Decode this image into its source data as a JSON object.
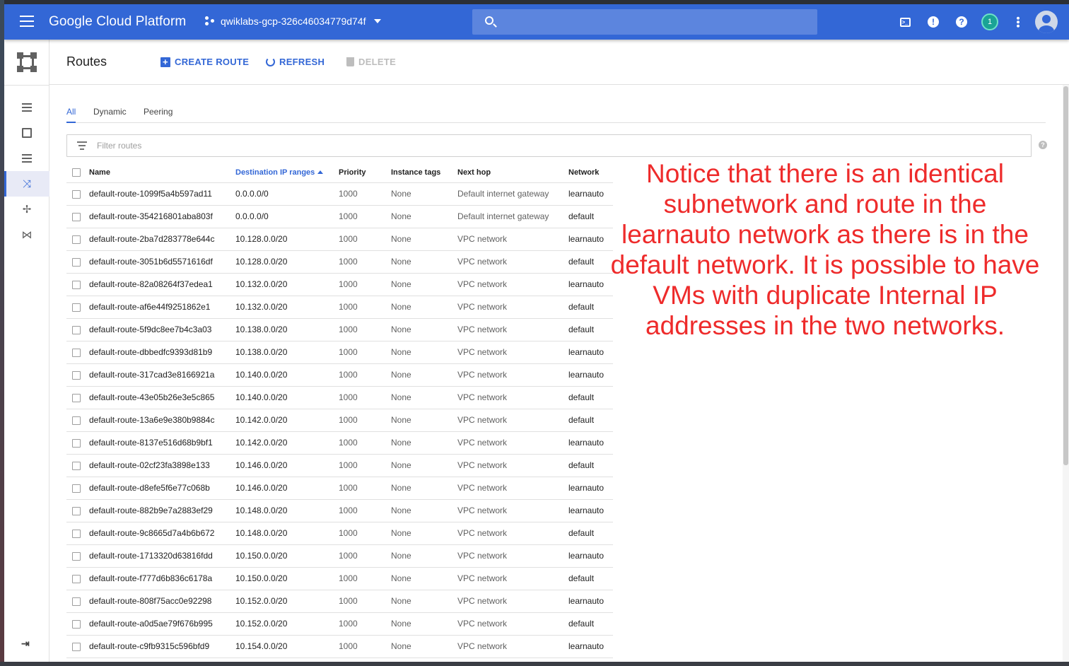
{
  "topbar": {
    "brand": "Google Cloud Platform",
    "project": "qwiklabs-gcp-326c46034779d74f",
    "search_placeholder": "",
    "notifications_count": "1",
    "shell_icon": "cloud-shell-icon",
    "alert_icon": "alert-icon",
    "help_icon": "help-icon",
    "more_icon": "more-vert-icon"
  },
  "header": {
    "title": "Routes",
    "create_label": "CREATE ROUTE",
    "refresh_label": "REFRESH",
    "delete_label": "DELETE"
  },
  "tabs": [
    {
      "label": "All",
      "active": true
    },
    {
      "label": "Dynamic",
      "active": false
    },
    {
      "label": "Peering",
      "active": false
    }
  ],
  "filter": {
    "placeholder": "Filter routes"
  },
  "table": {
    "columns": [
      "Name",
      "Destination IP ranges",
      "Priority",
      "Instance tags",
      "Next hop",
      "Network"
    ],
    "sorted_column": "Destination IP ranges",
    "rows": [
      [
        "default-route-1099f5a4b597ad11",
        "0.0.0.0/0",
        "1000",
        "None",
        "Default internet gateway",
        "learnauto"
      ],
      [
        "default-route-354216801aba803f",
        "0.0.0.0/0",
        "1000",
        "None",
        "Default internet gateway",
        "default"
      ],
      [
        "default-route-2ba7d283778e644c",
        "10.128.0.0/20",
        "1000",
        "None",
        "VPC network",
        "learnauto"
      ],
      [
        "default-route-3051b6d5571616df",
        "10.128.0.0/20",
        "1000",
        "None",
        "VPC network",
        "default"
      ],
      [
        "default-route-82a08264f37edea1",
        "10.132.0.0/20",
        "1000",
        "None",
        "VPC network",
        "learnauto"
      ],
      [
        "default-route-af6e44f9251862e1",
        "10.132.0.0/20",
        "1000",
        "None",
        "VPC network",
        "default"
      ],
      [
        "default-route-5f9dc8ee7b4c3a03",
        "10.138.0.0/20",
        "1000",
        "None",
        "VPC network",
        "default"
      ],
      [
        "default-route-dbbedfc9393d81b9",
        "10.138.0.0/20",
        "1000",
        "None",
        "VPC network",
        "learnauto"
      ],
      [
        "default-route-317cad3e8166921a",
        "10.140.0.0/20",
        "1000",
        "None",
        "VPC network",
        "learnauto"
      ],
      [
        "default-route-43e05b26e3e5c865",
        "10.140.0.0/20",
        "1000",
        "None",
        "VPC network",
        "default"
      ],
      [
        "default-route-13a6e9e380b9884c",
        "10.142.0.0/20",
        "1000",
        "None",
        "VPC network",
        "default"
      ],
      [
        "default-route-8137e516d68b9bf1",
        "10.142.0.0/20",
        "1000",
        "None",
        "VPC network",
        "learnauto"
      ],
      [
        "default-route-02cf23fa3898e133",
        "10.146.0.0/20",
        "1000",
        "None",
        "VPC network",
        "default"
      ],
      [
        "default-route-d8efe5f6e77c068b",
        "10.146.0.0/20",
        "1000",
        "None",
        "VPC network",
        "learnauto"
      ],
      [
        "default-route-882b9e7a2883ef29",
        "10.148.0.0/20",
        "1000",
        "None",
        "VPC network",
        "learnauto"
      ],
      [
        "default-route-9c8665d7a4b6b672",
        "10.148.0.0/20",
        "1000",
        "None",
        "VPC network",
        "default"
      ],
      [
        "default-route-1713320d63816fdd",
        "10.150.0.0/20",
        "1000",
        "None",
        "VPC network",
        "learnauto"
      ],
      [
        "default-route-f777d6b836c6178a",
        "10.150.0.0/20",
        "1000",
        "None",
        "VPC network",
        "default"
      ],
      [
        "default-route-808f75acc0e92298",
        "10.152.0.0/20",
        "1000",
        "None",
        "VPC network",
        "learnauto"
      ],
      [
        "default-route-a0d5ae79f676b995",
        "10.152.0.0/20",
        "1000",
        "None",
        "VPC network",
        "default"
      ],
      [
        "default-route-c9fb9315c596bfd9",
        "10.154.0.0/20",
        "1000",
        "None",
        "VPC network",
        "learnauto"
      ]
    ]
  },
  "annotation": "Notice that there is an identical subnetwork and route in the learnauto network as there is in the default network. It is possible to have VMs with duplicate Internal IP addresses in the two networks.",
  "colors": {
    "topbar": "#3367d6",
    "accent": "#3367d6",
    "annotation": "#ee2b2b"
  }
}
